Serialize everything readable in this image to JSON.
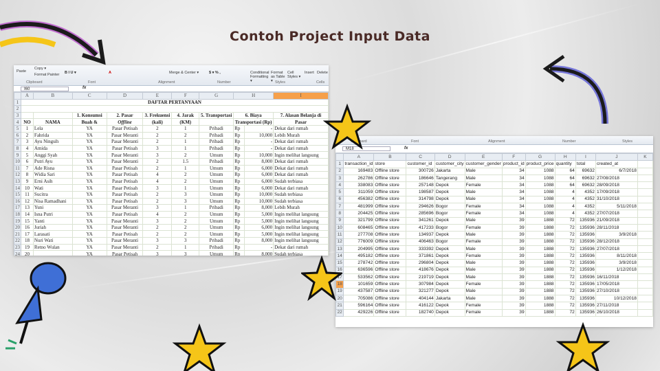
{
  "title": "Contoh Project Input Data",
  "colors": {
    "title": "#4a2a26",
    "star": "#f5c518",
    "arrow_left": "#1b1b1b",
    "arrow_left_glow": "#b23cc8",
    "arrow_right_glow": "#5b5bd6",
    "pin": "#3f6fd6",
    "selected_col": "#f6a04a"
  },
  "sheet1": {
    "ribbon": {
      "paste": "Paste",
      "copy": "Copy ▾",
      "format_painter": "Format Painter",
      "clipboard": "Clipboard",
      "font_buttons": "B  I  U ▾",
      "font": "Font",
      "merge": "Merge & Center ▾",
      "alignment": "Alignment",
      "number_fmt": "$ ▾ %  ,",
      "number": "Number",
      "conditional": "Conditional Formatting ▾",
      "format_table": "Format as Table ▾",
      "cell_styles": "Cell Styles ▾",
      "styles": "Styles",
      "insert": "Insert",
      "delete": "Delete",
      "cells": "Cells"
    },
    "name_box": "I60",
    "fx": "fx",
    "columns": [
      "A",
      "B",
      "C",
      "D",
      "E",
      "F",
      "G",
      "H",
      "I"
    ],
    "title_row": "DAFTAR PERTANYAAN",
    "headers": {
      "no": "NO",
      "nama": "NAMA",
      "c1": "1. Konsumsi",
      "c2": "Buah &",
      "d1": "2. Pasar",
      "d2": "Offline",
      "e1": "3. Frekuensi",
      "e2": "(kali)",
      "f1": "4. Jarak",
      "f2": "(KM)",
      "g": "5. Transportasi",
      "h1": "6. Biaya",
      "h2": "Transportasi (Rp)",
      "i1": "7. Alasan Belanja di",
      "i2": "Pasar"
    },
    "rows": [
      [
        "1",
        "Lela",
        "YA",
        "Pasar Petisah",
        "2",
        "1",
        "Pribadi",
        "Rp",
        "-",
        "Dekat dari rumah"
      ],
      [
        "2",
        "Fahrida",
        "YA",
        "Pasar Meranti",
        "2",
        "2",
        "Pribadi",
        "Rp",
        "10,000",
        "Lebih Murah"
      ],
      [
        "3",
        "Ayu Ningsih",
        "YA",
        "Pasar Meranti",
        "2",
        "1",
        "Pribadi",
        "Rp",
        "-",
        "Dekat dari rumah"
      ],
      [
        "4",
        "Amida",
        "YA",
        "Pasar Petisah",
        "3",
        "1",
        "Pribadi",
        "Rp",
        "-",
        "Dekat dari rumah"
      ],
      [
        "5",
        "Anggi Syah",
        "YA",
        "Pasar Meranti",
        "3",
        "2",
        "Umum",
        "Rp",
        "10,000",
        "Ingin melihat langsung"
      ],
      [
        "6",
        "Putri Ayu",
        "YA",
        "Pasar Meranti",
        "2",
        "1.5",
        "Pribadi",
        "Rp",
        "8,000",
        "Dekat dari rumah"
      ],
      [
        "7",
        "Ade Risna",
        "YA",
        "Pasar Petisah",
        "2",
        "1",
        "Umum",
        "Rp",
        "6,000",
        "Dekat dari rumah"
      ],
      [
        "8",
        "Widia Sari",
        "YA",
        "Pasar Petisah",
        "4",
        "2",
        "Umum",
        "Rp",
        "6,000",
        "Dekat dari rumah"
      ],
      [
        "9",
        "Erni Asih",
        "YA",
        "Pasar Petisah",
        "4",
        "2",
        "Umum",
        "Rp",
        "6,000",
        "Sudah terbiasa"
      ],
      [
        "10",
        "Wati",
        "YA",
        "Pasar Petisah",
        "3",
        "1",
        "Umum",
        "Rp",
        "6,000",
        "Dekat dari rumah"
      ],
      [
        "11",
        "Sucitra",
        "YA",
        "Pasar Petisah",
        "2",
        "3",
        "Umum",
        "Rp",
        "10,000",
        "Sudah terbiasa"
      ],
      [
        "12",
        "Nisa Ramadhani",
        "YA",
        "Pasar Petisah",
        "2",
        "3",
        "Umum",
        "Rp",
        "10,000",
        "Sudah terbiasa"
      ],
      [
        "13",
        "Yuni",
        "YA",
        "Pasar Meranti",
        "3",
        "1",
        "Pribadi",
        "Rp",
        "8,000",
        "Lebih Murah"
      ],
      [
        "14",
        "Isna Putri",
        "YA",
        "Pasar Petisah",
        "4",
        "2",
        "Umum",
        "Rp",
        "5,000",
        "Ingin melihat langsung"
      ],
      [
        "15",
        "Yanti",
        "YA",
        "Pasar Meranti",
        "3",
        "2",
        "Umum",
        "Rp",
        "5,000",
        "Ingin melihat langsung"
      ],
      [
        "16",
        "Juriah",
        "YA",
        "Pasar Meranti",
        "2",
        "2",
        "Umum",
        "Rp",
        "6,000",
        "Ingin melihat langsung"
      ],
      [
        "17",
        "Larasati",
        "YA",
        "Pasar Petisah",
        "2",
        "2",
        "Umum",
        "Rp",
        "5,000",
        "Ingin melihat langsung"
      ],
      [
        "18",
        "Nuri Wati",
        "YA",
        "Pasar Meranti",
        "3",
        "3",
        "Pribadi",
        "Rp",
        "8,000",
        "Ingin melihat langsung"
      ],
      [
        "19",
        "Retno Wulan",
        "YA",
        "Pasar Meranti",
        "2",
        "1",
        "Pribadi",
        "Rp",
        "-",
        "Dekat dari rumah"
      ],
      [
        "20",
        "",
        "YA",
        "Pasar Petisah",
        "3",
        "3",
        "Umum",
        "Rp",
        "8,000",
        "Sudah terbiasa"
      ]
    ]
  },
  "sheet2": {
    "ribbon": {
      "clipboard": "Clipboard",
      "font": "Font",
      "alignment": "Alignment",
      "number": "Number",
      "styles": "Styles"
    },
    "name_box": "M18",
    "fx": "fx",
    "columns": [
      "A",
      "B",
      "C",
      "D",
      "E",
      "F",
      "G",
      "H",
      "I",
      "J",
      "K"
    ],
    "headers": [
      "transaction_id",
      "store",
      "customer_id",
      "customer_city",
      "customer_gender",
      "product_id",
      "product_price",
      "quantity",
      "total",
      "created_at",
      ""
    ],
    "rows": [
      {
        "v": [
          "169483",
          "Offline store",
          "300726",
          "Jakarta",
          "Male",
          "34",
          "1088",
          "64",
          "69632",
          "6/7/2018"
        ],
        "date_right": true
      },
      {
        "v": [
          "262786",
          "Offline store",
          "186646",
          "Tangerang",
          "Male",
          "34",
          "1088",
          "64",
          "69632",
          "27/08/2018"
        ],
        "date_right": false
      },
      {
        "v": [
          "338083",
          "Offline store",
          "257148",
          "Depok",
          "Female",
          "34",
          "1088",
          "64",
          "69632",
          "28/09/2018"
        ],
        "date_right": false
      },
      {
        "v": [
          "311059",
          "Offline store",
          "198587",
          "Depok",
          "Male",
          "34",
          "1088",
          "4",
          "4352",
          "17/09/2018"
        ],
        "date_right": false
      },
      {
        "v": [
          "456382",
          "Offline store",
          "314798",
          "Depok",
          "Male",
          "34",
          "1088",
          "4",
          "4352",
          "31/10/2018"
        ],
        "date_right": false
      },
      {
        "v": [
          "481999",
          "Offline store",
          "294626",
          "Bogor",
          "Female",
          "34",
          "1088",
          "4",
          "4352",
          "5/11/2018"
        ],
        "date_right": true
      },
      {
        "v": [
          "204425",
          "Offline store",
          "285696",
          "Bogor",
          "Female",
          "34",
          "1088",
          "4",
          "4352",
          "27/07/2018"
        ],
        "date_right": false
      },
      {
        "v": [
          "321799",
          "Offline store",
          "341261",
          "Depok",
          "Male",
          "39",
          "1888",
          "72",
          "135936",
          "21/09/2018"
        ],
        "date_right": false
      },
      {
        "v": [
          "608465",
          "Offline store",
          "417233",
          "Bogor",
          "Female",
          "39",
          "1888",
          "72",
          "135936",
          "28/11/2018"
        ],
        "date_right": false
      },
      {
        "v": [
          "277708",
          "Offline store",
          "134937",
          "Depok",
          "Male",
          "39",
          "1888",
          "72",
          "135936",
          "3/9/2018"
        ],
        "date_right": true
      },
      {
        "v": [
          "776009",
          "Offline store",
          "406463",
          "Bogor",
          "Female",
          "39",
          "1888",
          "72",
          "135936",
          "28/12/2018"
        ],
        "date_right": false
      },
      {
        "v": [
          "204995",
          "Offline store",
          "333392",
          "Depok",
          "Male",
          "39",
          "1888",
          "72",
          "135936",
          "27/07/2018"
        ],
        "date_right": false
      },
      {
        "v": [
          "495182",
          "Offline store",
          "371861",
          "Depok",
          "Female",
          "39",
          "1888",
          "72",
          "135936",
          "8/11/2018"
        ],
        "date_right": true
      },
      {
        "v": [
          "278742",
          "Offline store",
          "296804",
          "Depok",
          "Male",
          "39",
          "1888",
          "72",
          "135936",
          "3/9/2018"
        ],
        "date_right": true
      },
      {
        "v": [
          "636596",
          "Offline store",
          "418676",
          "Depok",
          "Male",
          "39",
          "1888",
          "72",
          "135936",
          "1/12/2018"
        ],
        "date_right": true
      },
      {
        "v": [
          "533562",
          "Offline store",
          "219719",
          "Depok",
          "Male",
          "39",
          "1888",
          "72",
          "135936",
          "16/11/2018"
        ],
        "date_right": false
      },
      {
        "v": [
          "101659",
          "Offline store",
          "307984",
          "Depok",
          "Female",
          "39",
          "1888",
          "72",
          "135936",
          "17/05/2018"
        ],
        "date_right": false
      },
      {
        "v": [
          "437587",
          "Offline store",
          "321277",
          "Depok",
          "Male",
          "39",
          "1888",
          "72",
          "135936",
          "27/10/2018"
        ],
        "date_right": false
      },
      {
        "v": [
          "705086",
          "Offline store",
          "404144",
          "Jakarta",
          "Male",
          "39",
          "1888",
          "72",
          "135936",
          "10/12/2018"
        ],
        "date_right": true
      },
      {
        "v": [
          "596164",
          "Offline store",
          "416122",
          "Depok",
          "Female",
          "39",
          "1888",
          "72",
          "135936",
          "27/11/2018"
        ],
        "date_right": false
      },
      {
        "v": [
          "429226",
          "Offline store",
          "182740",
          "Depok",
          "Female",
          "39",
          "1888",
          "72",
          "135936",
          "26/10/2018"
        ],
        "date_right": false
      }
    ]
  }
}
